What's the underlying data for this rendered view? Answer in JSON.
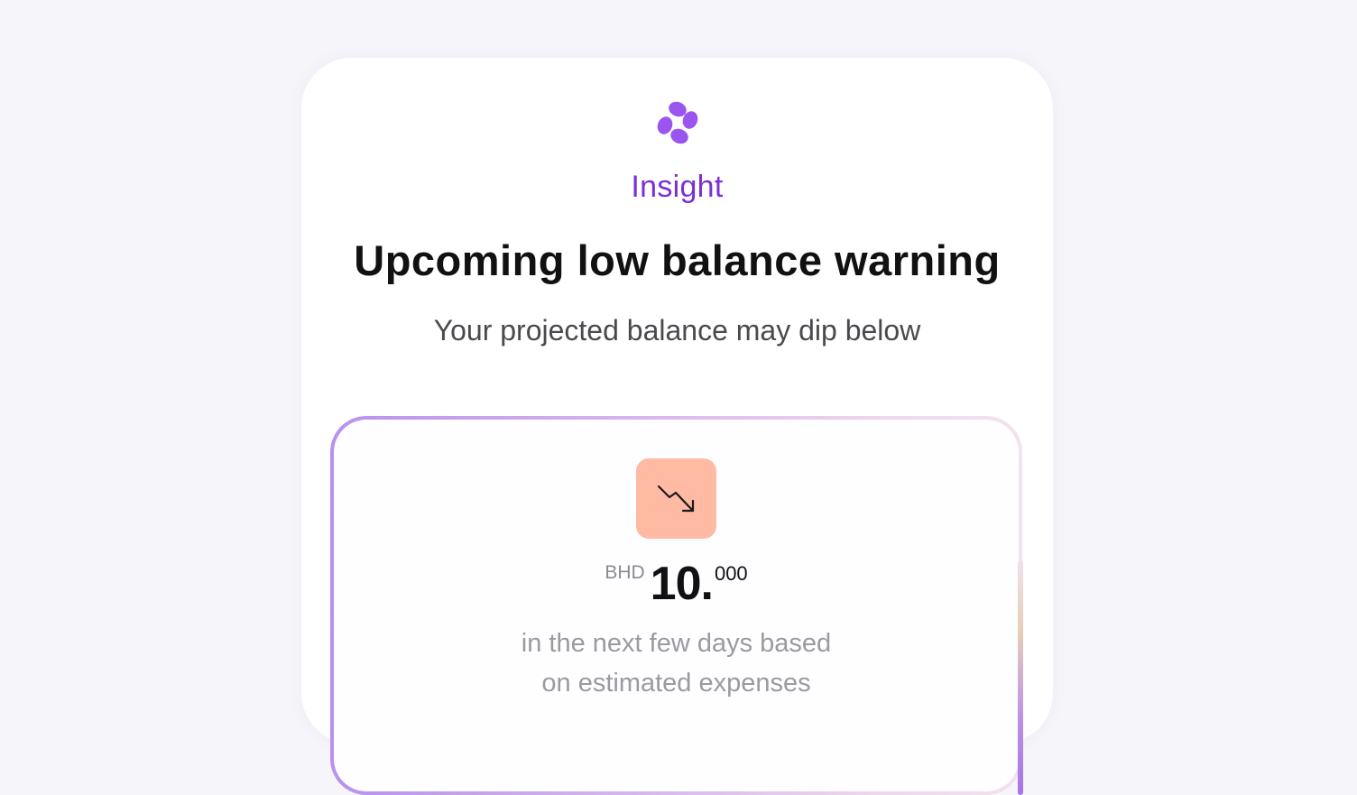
{
  "insight_card": {
    "logo_icon": "purple-four-petal-logo-icon",
    "eyebrow": "Insight",
    "title": "Upcoming low balance warning",
    "subtitle": "Your projected balance may dip below",
    "accent_color": "#7a2fd6",
    "balance_box": {
      "trend_icon": "trending-down-arrow-icon",
      "trend_tile_color": "#ffbaa4",
      "currency": "BHD",
      "amount_whole": "10.",
      "amount_fraction": "000",
      "caption_line1": "in the next few days based",
      "caption_line2": "on estimated expenses"
    }
  }
}
